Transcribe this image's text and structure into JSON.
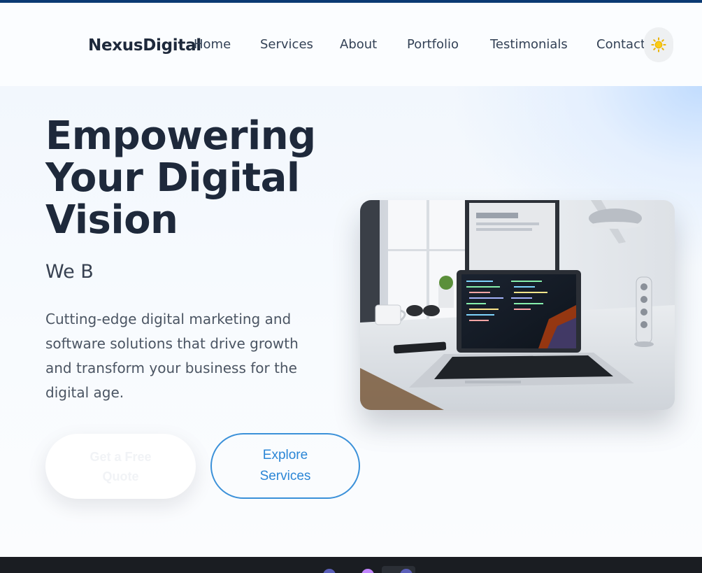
{
  "brand": {
    "name": "NexusDigital"
  },
  "nav": {
    "items": [
      {
        "label": "Home"
      },
      {
        "label": "Services"
      },
      {
        "label": "About"
      },
      {
        "label": "Portfolio"
      },
      {
        "label": "Testimonials"
      },
      {
        "label": "Contact"
      }
    ],
    "theme_icon": "sun-icon"
  },
  "hero": {
    "title": "Empowering Your Digital Vision",
    "typed_text": "We B",
    "description": "Cutting-edge digital marketing and software solutions that drive growth and transform your business for the digital age.",
    "primary_cta": "Get a Free Quote",
    "secondary_cta": "Explore Services",
    "image_icon": "laptop-workspace-image"
  },
  "colors": {
    "brand_dark": "#1e293b",
    "accent": "#2b86d6",
    "top_strip": "#0b3a73",
    "sun": "#eab308"
  }
}
